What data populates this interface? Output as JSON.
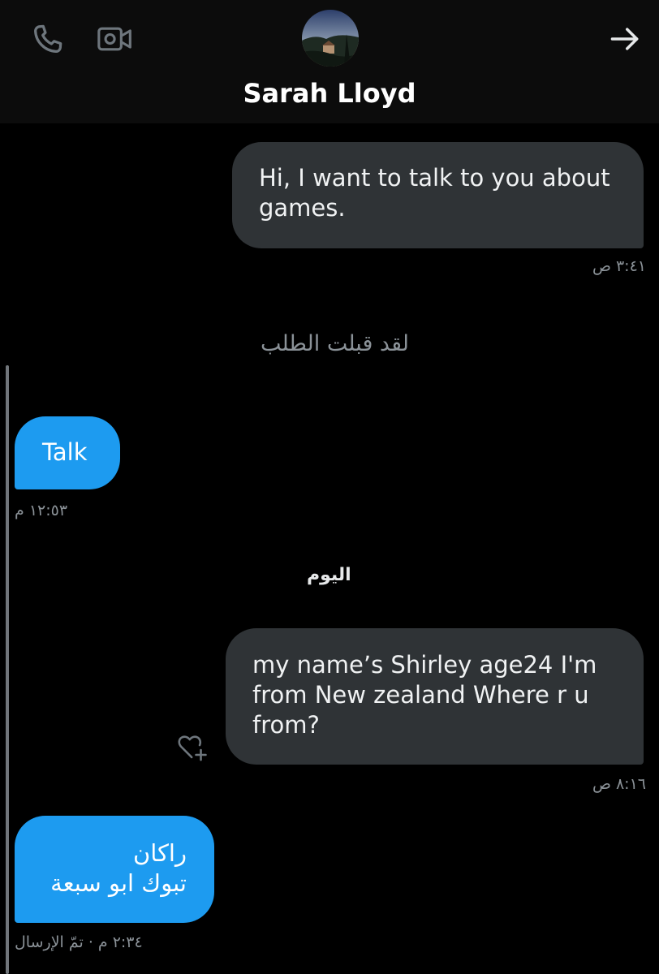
{
  "header": {
    "contact_name": "Sarah Lloyd",
    "icons": [
      "phone-icon",
      "video-call-icon",
      "arrow-right-icon"
    ]
  },
  "messages": [
    {
      "type": "received",
      "text": "Hi, I want to talk to you about\ngames.",
      "time": "٣:٤١ ص"
    },
    {
      "type": "system",
      "text": "لقد قبلت الطلب"
    },
    {
      "type": "sent",
      "text": "Talk",
      "time": "١٢:٥٣ م"
    },
    {
      "type": "day",
      "text": "اليوم"
    },
    {
      "type": "received",
      "text": "my name’s Shirley   age24  I'm\nfrom New zealand  Where r u\nfrom?",
      "time": "٨:١٦ ص"
    },
    {
      "type": "sent",
      "text": "راكان\nتبوك ابو سبعة",
      "time": "٢:٣٤ م · تمّ الإرسال"
    }
  ],
  "colors": {
    "sent_bubble": "#1d9bf0",
    "received_bubble": "#2f3336",
    "background": "#000000",
    "header_bg": "#0c0c0c"
  }
}
